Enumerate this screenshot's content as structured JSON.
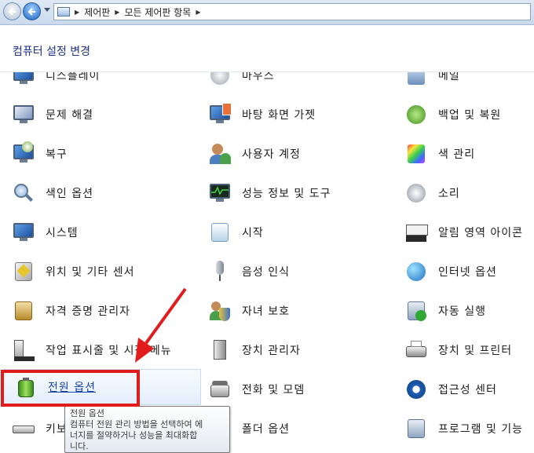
{
  "address_bar": {
    "crumbs": [
      "제어판",
      "모든 제어판 항목"
    ]
  },
  "header": {
    "title": "컴퓨터 설정 변경"
  },
  "items": [
    {
      "label": "디스플레이",
      "icon": "display-icon"
    },
    {
      "label": "마우스",
      "icon": "mouse-icon"
    },
    {
      "label": "메일",
      "icon": "mail-icon"
    },
    {
      "label": "문제 해결",
      "icon": "troubleshoot-icon"
    },
    {
      "label": "바탕 화면 가젯",
      "icon": "gadgets-icon"
    },
    {
      "label": "백업 및 복원",
      "icon": "backup-icon"
    },
    {
      "label": "복구",
      "icon": "recovery-icon"
    },
    {
      "label": "사용자 계정",
      "icon": "user-accounts-icon"
    },
    {
      "label": "색 관리",
      "icon": "color-management-icon"
    },
    {
      "label": "색인 옵션",
      "icon": "indexing-icon"
    },
    {
      "label": "성능 정보 및 도구",
      "icon": "performance-icon"
    },
    {
      "label": "소리",
      "icon": "sound-icon"
    },
    {
      "label": "시스템",
      "icon": "system-icon"
    },
    {
      "label": "시작",
      "icon": "getting-started-icon"
    },
    {
      "label": "알림 영역 아이콘",
      "icon": "notification-icon"
    },
    {
      "label": "위치 및 기타 센서",
      "icon": "location-sensor-icon"
    },
    {
      "label": "음성 인식",
      "icon": "speech-icon"
    },
    {
      "label": "인터넷 옵션",
      "icon": "internet-options-icon"
    },
    {
      "label": "자격 증명 관리자",
      "icon": "credential-icon"
    },
    {
      "label": "자녀 보호",
      "icon": "parental-controls-icon"
    },
    {
      "label": "자동 실행",
      "icon": "autoplay-icon"
    },
    {
      "label": "작업 표시줄 및 시작 메뉴",
      "icon": "taskbar-icon"
    },
    {
      "label": "장치 관리자",
      "icon": "device-manager-icon"
    },
    {
      "label": "장치 및 프린터",
      "icon": "devices-printers-icon"
    },
    {
      "label": "전원 옵션",
      "icon": "power-icon"
    },
    {
      "label": "전화 및 모뎀",
      "icon": "phone-modem-icon"
    },
    {
      "label": "접근성 센터",
      "icon": "ease-of-access-icon"
    },
    {
      "label": "키보드",
      "icon": "keyboard-icon"
    },
    {
      "label": "폴더 옵션",
      "icon": "folder-options-icon"
    },
    {
      "label": "프로그램 및 기능",
      "icon": "programs-icon"
    }
  ],
  "tooltip": {
    "title": "전원 옵션",
    "line1": "컴퓨터 전원 관리 방법을 선택하여 에",
    "line2": "너지를 절약하거나 성능을 최대화합",
    "line3": "니다."
  },
  "annotation": {
    "color": "#e21c1c"
  }
}
